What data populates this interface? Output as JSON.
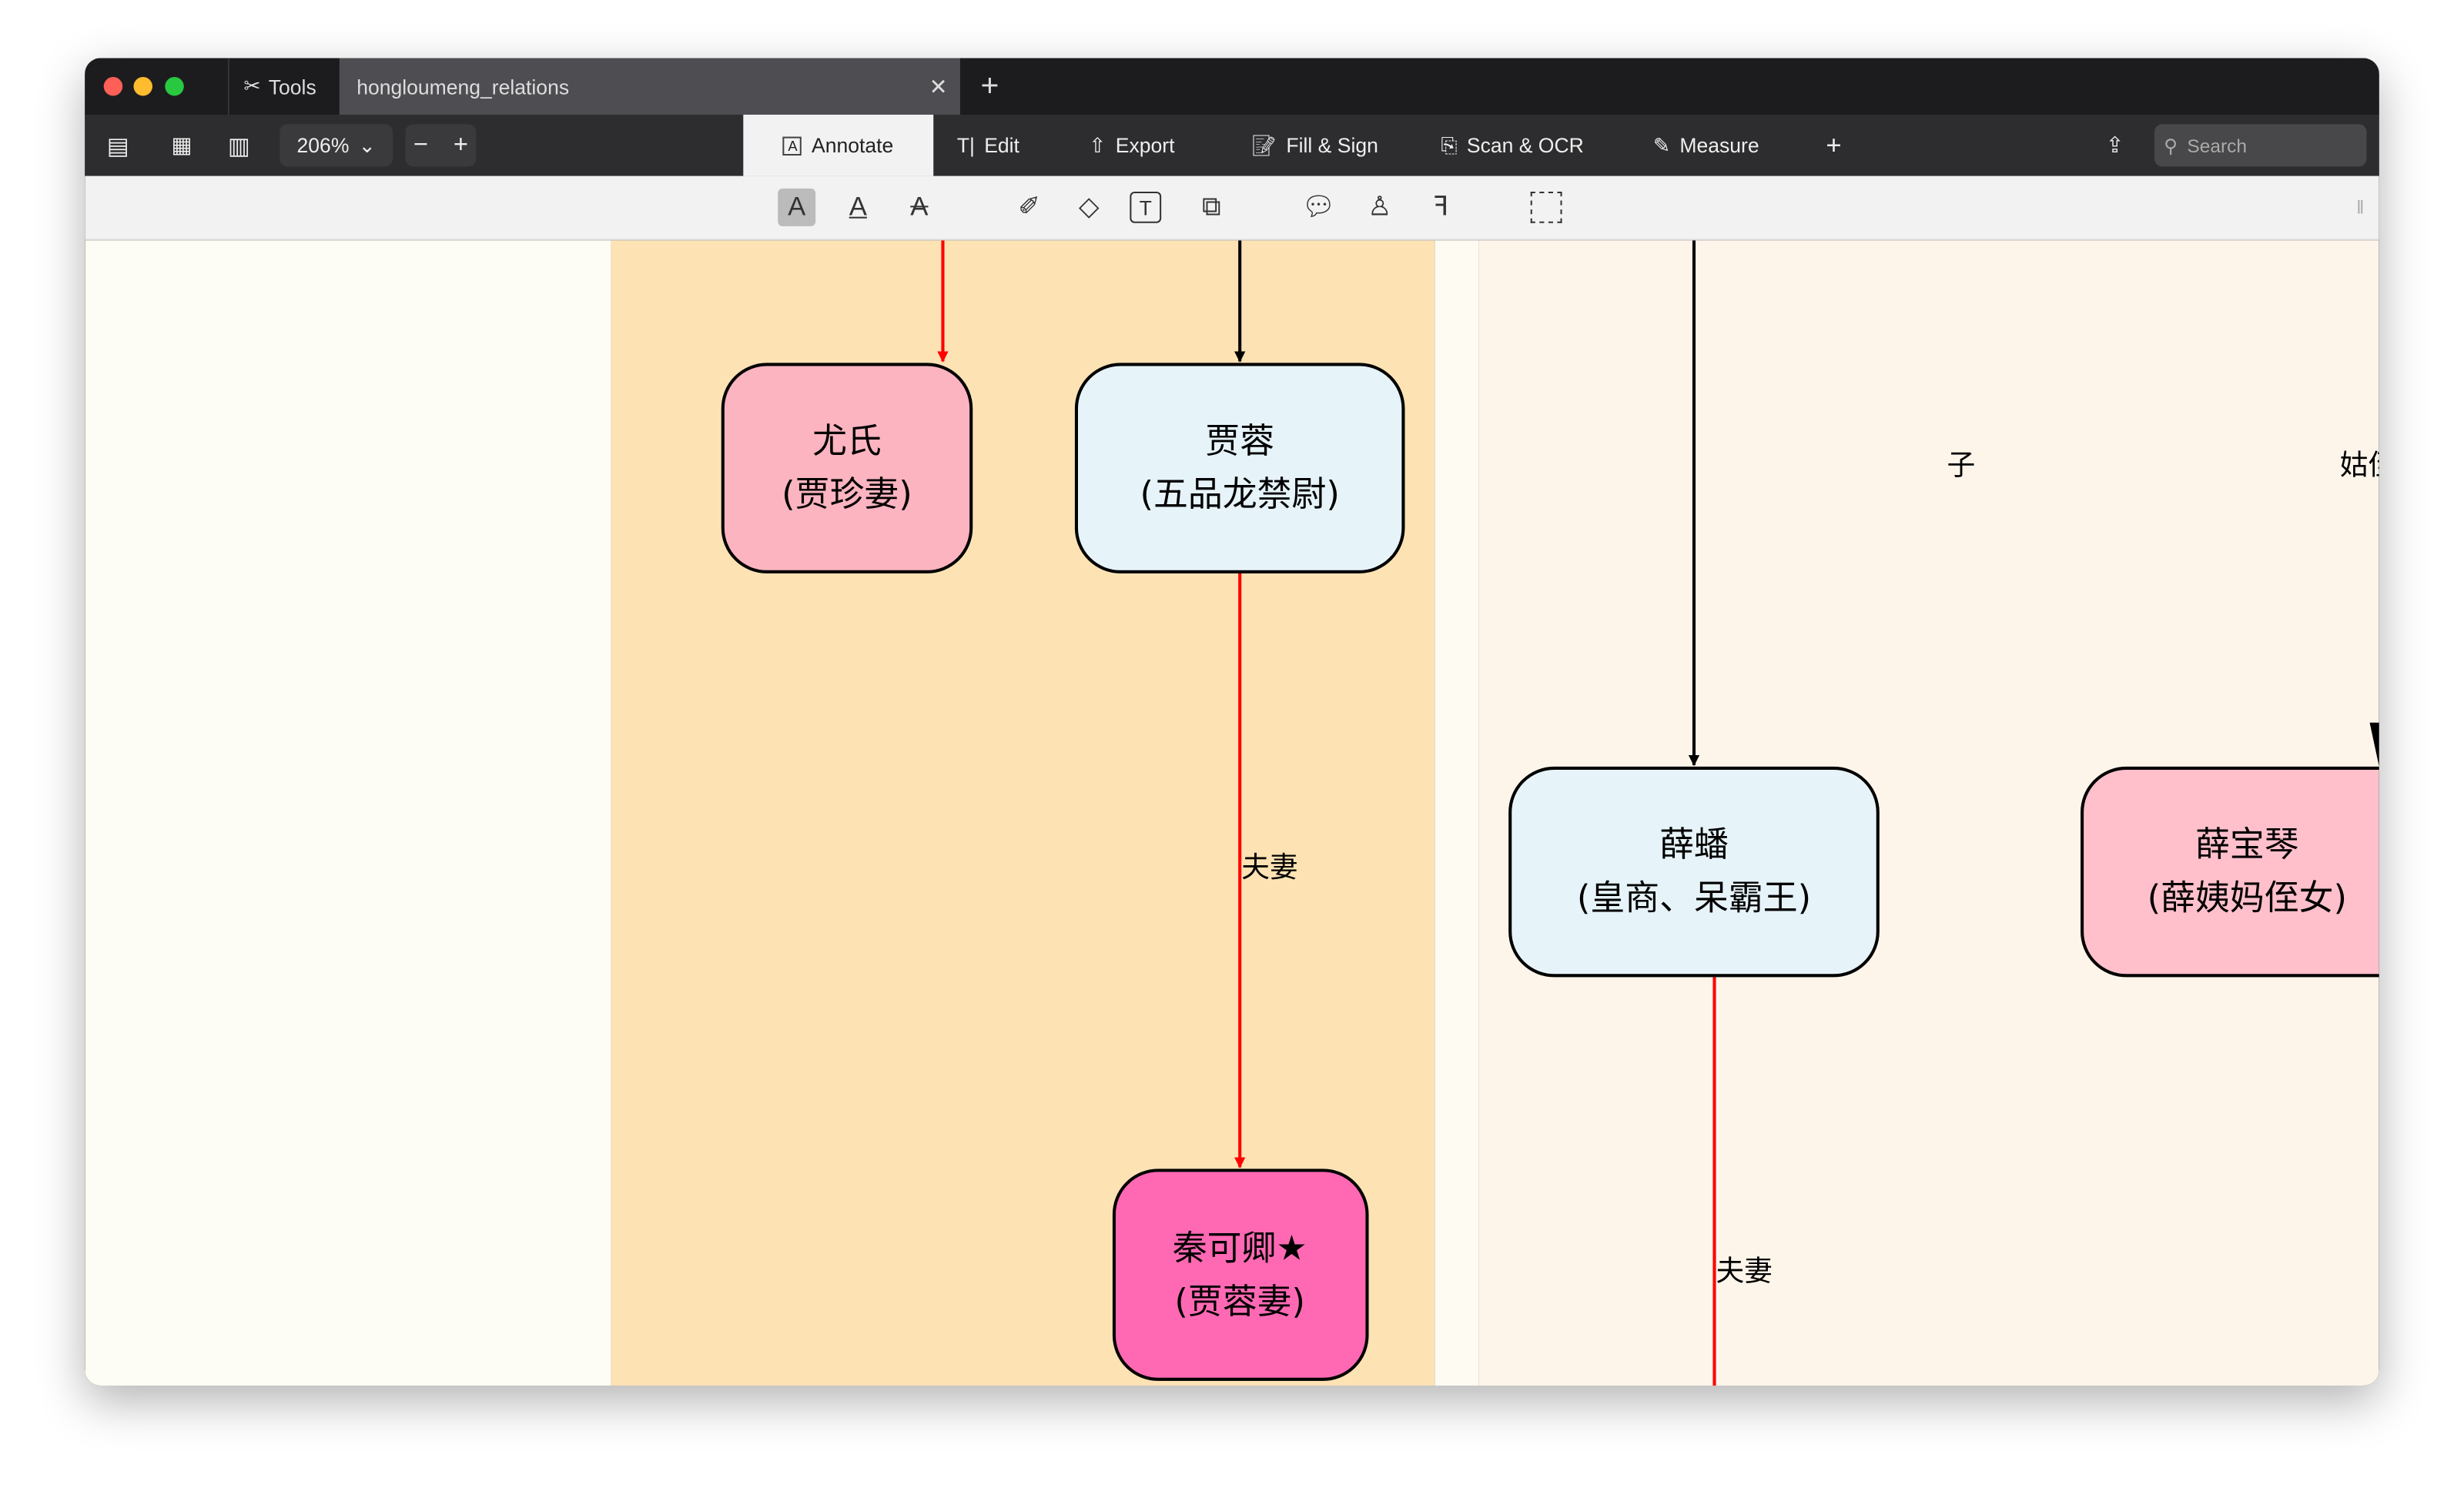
{
  "tabs": {
    "tools": "Tools",
    "document": "hongloumeng_relations"
  },
  "toolbar": {
    "zoom": "206%",
    "annotate": "Annotate",
    "edit": "Edit",
    "export": "Export",
    "fill_sign": "Fill & Sign",
    "scan_ocr": "Scan & OCR",
    "measure": "Measure",
    "search_placeholder": "Search"
  },
  "diagram": {
    "nodes": [
      {
        "name": "尤氏",
        "role": "(贾珍妻)",
        "color": "#fbb4c0"
      },
      {
        "name": "贾蓉",
        "role": "(五品龙禁尉)",
        "color": "#e6f3f9"
      },
      {
        "name": "秦可卿★",
        "role": "(贾蓉妻)",
        "color": "#ff69b4"
      },
      {
        "name": "薛蟠",
        "role": "(皇商、呆霸王)",
        "color": "#e6f3f9"
      },
      {
        "name": "薛宝琴",
        "role": "(薛姨妈侄女)",
        "color": "#ffc0cb"
      }
    ],
    "edge_labels": {
      "spouse1": "夫妻",
      "spouse2": "夫妻",
      "son": "子",
      "aunt": "姑侄"
    }
  }
}
